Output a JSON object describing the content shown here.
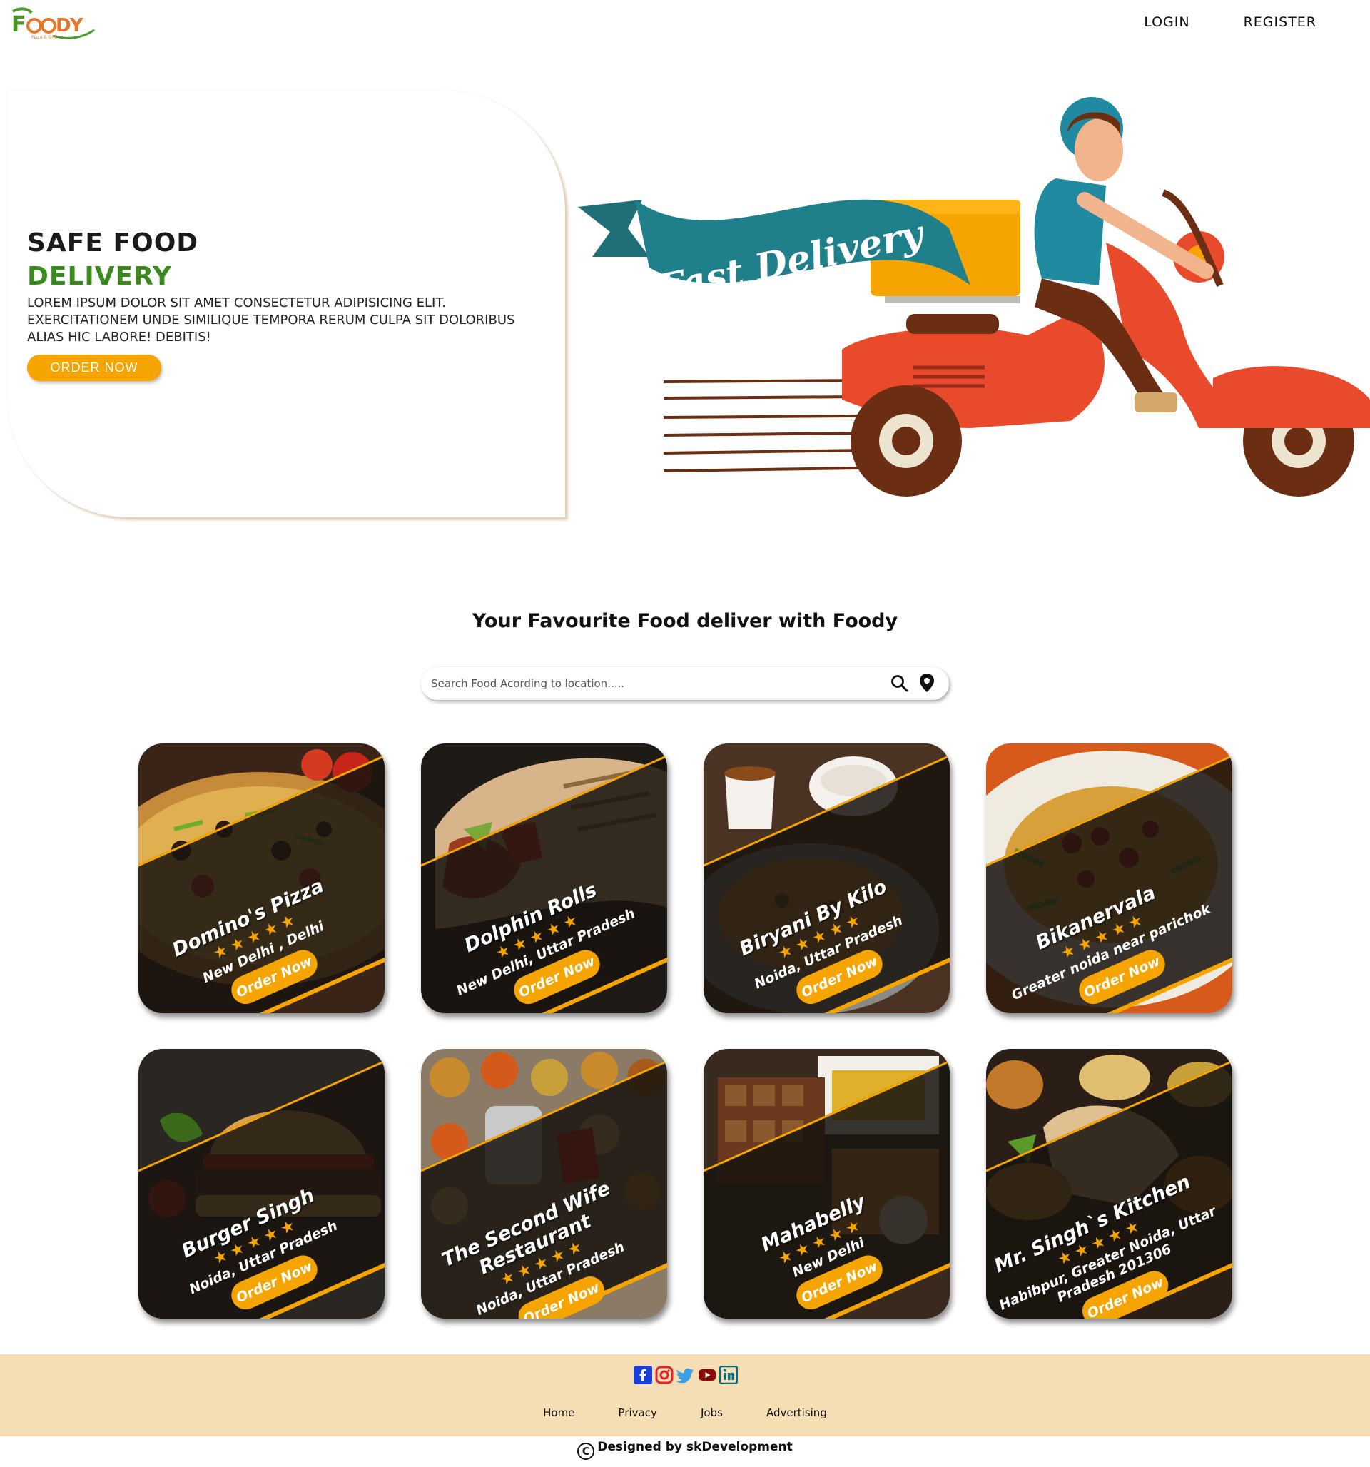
{
  "header": {
    "logo_name": "Foody",
    "logo_tagline": "Pizza & Grill",
    "login": "LOGIN",
    "register": "REGISTER"
  },
  "hero": {
    "title_line1": "SAFE FOOD",
    "title_line2": "DELIVERY",
    "description": "Lorem ipsum dolor sit amet consectetur adipisicing elit. Exercitationem unde similique tempora rerum culpa sit doloribus alias hic labore! Debitis!",
    "order_button": "ORDER NOW",
    "banner_text": "Fast Delivery",
    "accent_color": "#f5a400",
    "green_color": "#3a8a1e"
  },
  "section": {
    "title": "Your Favourite Food deliver with Foody"
  },
  "search": {
    "placeholder": "Search Food Acording to location.....",
    "value": "",
    "search_icon": "search-icon",
    "location_icon": "location-pin-icon"
  },
  "restaurants": [
    {
      "name": "Domino's Pizza",
      "rating": "★★★★★",
      "location": "New Delhi , Delhi",
      "button": "Order Now"
    },
    {
      "name": "Dolphin Rolls",
      "rating": "★★★★★",
      "location": "New Delhi, Uttar Pradesh",
      "button": "Order Now"
    },
    {
      "name": "Biryani By Kilo",
      "rating": "★★★★★",
      "location": "Noida, Uttar Pradesh",
      "button": "Order Now"
    },
    {
      "name": "Bikanervala",
      "rating": "★★★★★",
      "location": "Greater noida near parichok",
      "button": "Order Now"
    },
    {
      "name": "Burger Singh",
      "rating": "★★★★★",
      "location": "Noida, Uttar Pradesh",
      "button": "Order Now"
    },
    {
      "name": "The Second Wife Restaurant",
      "rating": "★★★★★",
      "location": "Noida, Uttar Pradesh",
      "button": "Order Now"
    },
    {
      "name": "Mahabelly",
      "rating": "★★★★★",
      "location": "New Delhi",
      "button": "Order Now"
    },
    {
      "name": "Mr. Singh`s Kitchen",
      "rating": "★★★★★",
      "location": "Habibpur, Greater Noida, Uttar Pradesh 201306",
      "button": "Order Now"
    }
  ],
  "footer": {
    "social_icons": [
      "facebook-icon",
      "instagram-icon",
      "twitter-icon",
      "youtube-icon",
      "linkedin-icon"
    ],
    "links": [
      "Home",
      "Privacy",
      "Jobs",
      "Advertising"
    ],
    "copyright_symbol": "C",
    "copyright": "Designed by skDevelopment",
    "background_color": "#f5deb3"
  }
}
